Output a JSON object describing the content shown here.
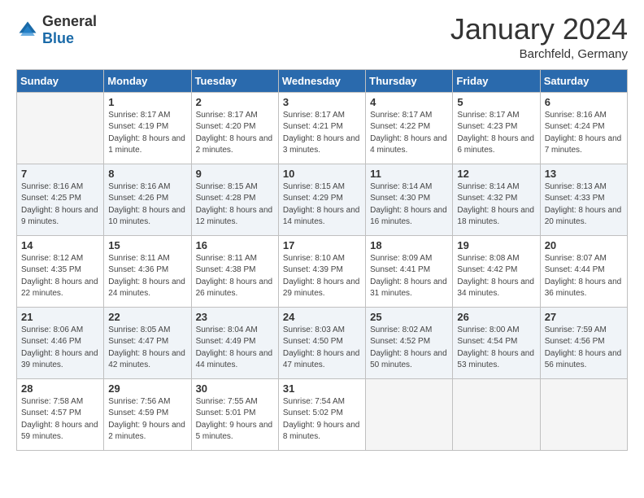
{
  "logo": {
    "text_general": "General",
    "text_blue": "Blue"
  },
  "header": {
    "month": "January 2024",
    "location": "Barchfeld, Germany"
  },
  "weekdays": [
    "Sunday",
    "Monday",
    "Tuesday",
    "Wednesday",
    "Thursday",
    "Friday",
    "Saturday"
  ],
  "weeks": [
    [
      {
        "day": "",
        "empty": true
      },
      {
        "day": "1",
        "sunrise": "Sunrise: 8:17 AM",
        "sunset": "Sunset: 4:19 PM",
        "daylight": "Daylight: 8 hours and 1 minute."
      },
      {
        "day": "2",
        "sunrise": "Sunrise: 8:17 AM",
        "sunset": "Sunset: 4:20 PM",
        "daylight": "Daylight: 8 hours and 2 minutes."
      },
      {
        "day": "3",
        "sunrise": "Sunrise: 8:17 AM",
        "sunset": "Sunset: 4:21 PM",
        "daylight": "Daylight: 8 hours and 3 minutes."
      },
      {
        "day": "4",
        "sunrise": "Sunrise: 8:17 AM",
        "sunset": "Sunset: 4:22 PM",
        "daylight": "Daylight: 8 hours and 4 minutes."
      },
      {
        "day": "5",
        "sunrise": "Sunrise: 8:17 AM",
        "sunset": "Sunset: 4:23 PM",
        "daylight": "Daylight: 8 hours and 6 minutes."
      },
      {
        "day": "6",
        "sunrise": "Sunrise: 8:16 AM",
        "sunset": "Sunset: 4:24 PM",
        "daylight": "Daylight: 8 hours and 7 minutes."
      }
    ],
    [
      {
        "day": "7",
        "sunrise": "Sunrise: 8:16 AM",
        "sunset": "Sunset: 4:25 PM",
        "daylight": "Daylight: 8 hours and 9 minutes."
      },
      {
        "day": "8",
        "sunrise": "Sunrise: 8:16 AM",
        "sunset": "Sunset: 4:26 PM",
        "daylight": "Daylight: 8 hours and 10 minutes."
      },
      {
        "day": "9",
        "sunrise": "Sunrise: 8:15 AM",
        "sunset": "Sunset: 4:28 PM",
        "daylight": "Daylight: 8 hours and 12 minutes."
      },
      {
        "day": "10",
        "sunrise": "Sunrise: 8:15 AM",
        "sunset": "Sunset: 4:29 PM",
        "daylight": "Daylight: 8 hours and 14 minutes."
      },
      {
        "day": "11",
        "sunrise": "Sunrise: 8:14 AM",
        "sunset": "Sunset: 4:30 PM",
        "daylight": "Daylight: 8 hours and 16 minutes."
      },
      {
        "day": "12",
        "sunrise": "Sunrise: 8:14 AM",
        "sunset": "Sunset: 4:32 PM",
        "daylight": "Daylight: 8 hours and 18 minutes."
      },
      {
        "day": "13",
        "sunrise": "Sunrise: 8:13 AM",
        "sunset": "Sunset: 4:33 PM",
        "daylight": "Daylight: 8 hours and 20 minutes."
      }
    ],
    [
      {
        "day": "14",
        "sunrise": "Sunrise: 8:12 AM",
        "sunset": "Sunset: 4:35 PM",
        "daylight": "Daylight: 8 hours and 22 minutes."
      },
      {
        "day": "15",
        "sunrise": "Sunrise: 8:11 AM",
        "sunset": "Sunset: 4:36 PM",
        "daylight": "Daylight: 8 hours and 24 minutes."
      },
      {
        "day": "16",
        "sunrise": "Sunrise: 8:11 AM",
        "sunset": "Sunset: 4:38 PM",
        "daylight": "Daylight: 8 hours and 26 minutes."
      },
      {
        "day": "17",
        "sunrise": "Sunrise: 8:10 AM",
        "sunset": "Sunset: 4:39 PM",
        "daylight": "Daylight: 8 hours and 29 minutes."
      },
      {
        "day": "18",
        "sunrise": "Sunrise: 8:09 AM",
        "sunset": "Sunset: 4:41 PM",
        "daylight": "Daylight: 8 hours and 31 minutes."
      },
      {
        "day": "19",
        "sunrise": "Sunrise: 8:08 AM",
        "sunset": "Sunset: 4:42 PM",
        "daylight": "Daylight: 8 hours and 34 minutes."
      },
      {
        "day": "20",
        "sunrise": "Sunrise: 8:07 AM",
        "sunset": "Sunset: 4:44 PM",
        "daylight": "Daylight: 8 hours and 36 minutes."
      }
    ],
    [
      {
        "day": "21",
        "sunrise": "Sunrise: 8:06 AM",
        "sunset": "Sunset: 4:46 PM",
        "daylight": "Daylight: 8 hours and 39 minutes."
      },
      {
        "day": "22",
        "sunrise": "Sunrise: 8:05 AM",
        "sunset": "Sunset: 4:47 PM",
        "daylight": "Daylight: 8 hours and 42 minutes."
      },
      {
        "day": "23",
        "sunrise": "Sunrise: 8:04 AM",
        "sunset": "Sunset: 4:49 PM",
        "daylight": "Daylight: 8 hours and 44 minutes."
      },
      {
        "day": "24",
        "sunrise": "Sunrise: 8:03 AM",
        "sunset": "Sunset: 4:50 PM",
        "daylight": "Daylight: 8 hours and 47 minutes."
      },
      {
        "day": "25",
        "sunrise": "Sunrise: 8:02 AM",
        "sunset": "Sunset: 4:52 PM",
        "daylight": "Daylight: 8 hours and 50 minutes."
      },
      {
        "day": "26",
        "sunrise": "Sunrise: 8:00 AM",
        "sunset": "Sunset: 4:54 PM",
        "daylight": "Daylight: 8 hours and 53 minutes."
      },
      {
        "day": "27",
        "sunrise": "Sunrise: 7:59 AM",
        "sunset": "Sunset: 4:56 PM",
        "daylight": "Daylight: 8 hours and 56 minutes."
      }
    ],
    [
      {
        "day": "28",
        "sunrise": "Sunrise: 7:58 AM",
        "sunset": "Sunset: 4:57 PM",
        "daylight": "Daylight: 8 hours and 59 minutes."
      },
      {
        "day": "29",
        "sunrise": "Sunrise: 7:56 AM",
        "sunset": "Sunset: 4:59 PM",
        "daylight": "Daylight: 9 hours and 2 minutes."
      },
      {
        "day": "30",
        "sunrise": "Sunrise: 7:55 AM",
        "sunset": "Sunset: 5:01 PM",
        "daylight": "Daylight: 9 hours and 5 minutes."
      },
      {
        "day": "31",
        "sunrise": "Sunrise: 7:54 AM",
        "sunset": "Sunset: 5:02 PM",
        "daylight": "Daylight: 9 hours and 8 minutes."
      },
      {
        "day": "",
        "empty": true
      },
      {
        "day": "",
        "empty": true
      },
      {
        "day": "",
        "empty": true
      }
    ]
  ]
}
